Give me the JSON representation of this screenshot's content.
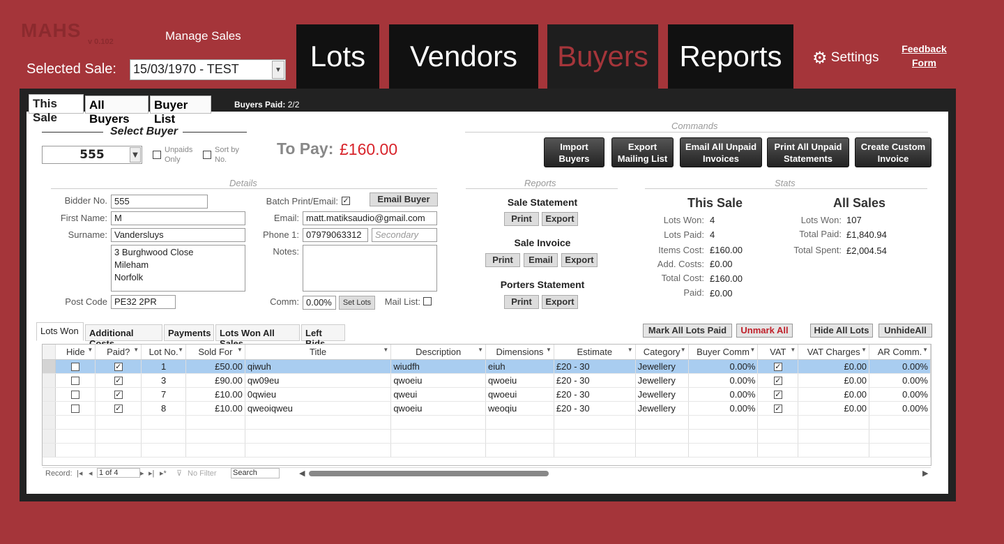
{
  "header": {
    "logo": "MAHS",
    "version": "v 0.102",
    "manage_label": "Manage Sales",
    "selected_sale_label": "Selected Sale:",
    "selected_sale_value": "15/03/1970 - TEST",
    "nav": [
      "Lots",
      "Vendors",
      "Buyers",
      "Reports"
    ],
    "settings_label": "Settings",
    "feedback_line1": "Feedback",
    "feedback_line2": "Form"
  },
  "tabs": [
    "This Sale",
    "All Buyers",
    "Buyer List"
  ],
  "buyers_paid_label": "Buyers Paid:",
  "buyers_paid_value": "2/2",
  "select_buyer": {
    "title": "Select Buyer",
    "value": "555",
    "unpaids_only": "Unpaids Only",
    "sort_by_no": "Sort by No."
  },
  "to_pay": {
    "label": "To Pay:",
    "value": "£160.00"
  },
  "commands": {
    "title": "Commands",
    "buttons": [
      "Import Buyers",
      "Export Mailing List",
      "Email All Unpaid Invoices",
      "Print All Unpaid Statements",
      "Create Custom Invoice"
    ]
  },
  "details": {
    "title": "Details",
    "bidder_no_label": "Bidder No.",
    "bidder_no": "555",
    "first_name_label": "First Name:",
    "first_name": "M",
    "surname_label": "Surname:",
    "surname": "Vandersluys",
    "address": [
      "3 Burghwood Close",
      "Mileham",
      "Norfolk"
    ],
    "post_code_label": "Post Code",
    "post_code": "PE32 2PR",
    "batch_label": "Batch Print/Email:",
    "email_buyer_btn": "Email Buyer",
    "email_label": "Email:",
    "email": "matt.matiksaudio@gmail.com",
    "phone_label": "Phone 1:",
    "phone": "07979063312",
    "secondary_placeholder": "Secondary",
    "notes_label": "Notes:",
    "comm_label": "Comm:",
    "comm": "0.00%",
    "set_lots_btn": "Set Lots",
    "mail_list_label": "Mail List:"
  },
  "reports": {
    "title": "Reports",
    "sale_statement": "Sale Statement",
    "sale_invoice": "Sale Invoice",
    "porters_statement": "Porters Statement",
    "print": "Print",
    "export": "Export",
    "email": "Email"
  },
  "stats": {
    "title": "Stats",
    "this_sale_title": "This Sale",
    "all_sales_title": "All Sales",
    "this_sale": [
      {
        "label": "Lots Won:",
        "value": "4"
      },
      {
        "label": "Lots Paid:",
        "value": "4"
      },
      {
        "label": "Items Cost:",
        "value": "£160.00"
      },
      {
        "label": "Add. Costs:",
        "value": "£0.00"
      },
      {
        "label": "Total Cost:",
        "value": "£160.00"
      },
      {
        "label": "Paid:",
        "value": "£0.00"
      }
    ],
    "all_sales": [
      {
        "label": "Lots Won:",
        "value": "107"
      },
      {
        "label": "Total Paid:",
        "value": "£1,840.94"
      },
      {
        "label": "Total Spent:",
        "value": "£2,004.54"
      }
    ]
  },
  "subtabs": [
    "Lots Won",
    "Additional Costs",
    "Payments",
    "Lots Won All Sales",
    "Left Bids"
  ],
  "actions": [
    "Mark All Lots Paid",
    "Unmark All",
    "Hide All Lots",
    "UnhideAll"
  ],
  "grid": {
    "columns": [
      "Hide",
      "Paid?",
      "Lot No.",
      "Sold For",
      "Title",
      "Description",
      "Dimensions",
      "Estimate",
      "Category",
      "Buyer Comm",
      "VAT",
      "VAT Charges",
      "AR Comm."
    ],
    "rows": [
      {
        "hide": false,
        "paid": true,
        "lot": "1",
        "sold": "£50.00",
        "title": "qiwuh",
        "desc": "wiudfh",
        "dim": "eiuh",
        "est": "£20 - 30",
        "cat": "Jewellery",
        "bc": "0.00%",
        "vat": true,
        "vatc": "£0.00",
        "ar": "0.00%"
      },
      {
        "hide": false,
        "paid": true,
        "lot": "3",
        "sold": "£90.00",
        "title": "qw09eu",
        "desc": "qwoeiu",
        "dim": "qwoeiu",
        "est": "£20 - 30",
        "cat": "Jewellery",
        "bc": "0.00%",
        "vat": true,
        "vatc": "£0.00",
        "ar": "0.00%"
      },
      {
        "hide": false,
        "paid": true,
        "lot": "7",
        "sold": "£10.00",
        "title": "0qwieu",
        "desc": "qweui",
        "dim": "qwoeui",
        "est": "£20 - 30",
        "cat": "Jewellery",
        "bc": "0.00%",
        "vat": true,
        "vatc": "£0.00",
        "ar": "0.00%"
      },
      {
        "hide": false,
        "paid": true,
        "lot": "8",
        "sold": "£10.00",
        "title": "qweoiqweu",
        "desc": "qwoeiu",
        "dim": "weoqiu",
        "est": "£20 - 30",
        "cat": "Jewellery",
        "bc": "0.00%",
        "vat": true,
        "vatc": "£0.00",
        "ar": "0.00%"
      }
    ]
  },
  "record_nav": {
    "label": "Record:",
    "position": "1 of 4",
    "filter": "No Filter",
    "search": "Search"
  },
  "colors": {
    "background": "#a5353a",
    "nav_dark": "#111111",
    "accent_red": "#d8242b",
    "selected_row": "#a9cdf0"
  }
}
